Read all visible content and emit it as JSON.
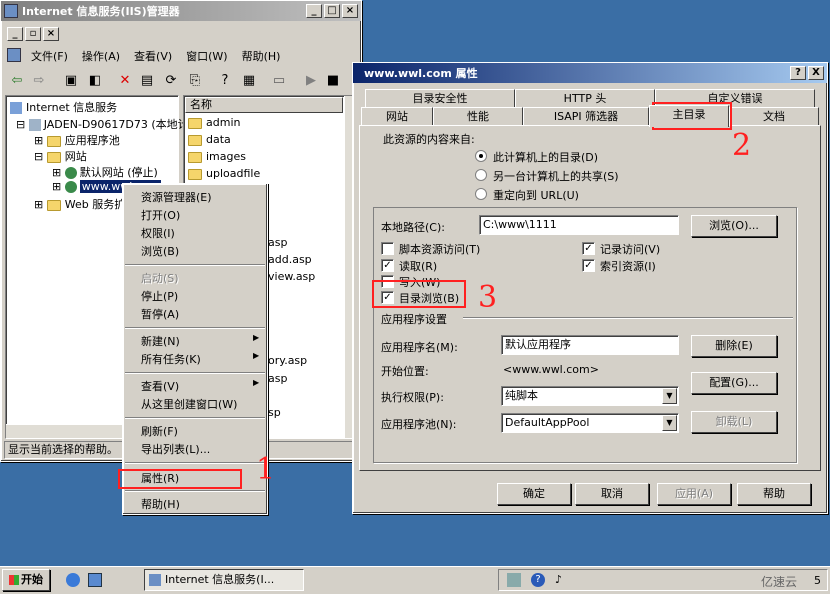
{
  "iis": {
    "title": "Internet 信息服务(IIS)管理器",
    "menu": [
      "文件(F)",
      "操作(A)",
      "查看(V)",
      "窗口(W)",
      "帮助(H)"
    ],
    "tree": {
      "root": "Internet 信息服务",
      "server": "JADEN-D90617D73 (本地计",
      "app_pools": "应用程序池",
      "websites": "网站",
      "default_site": "默认网站 (停止)",
      "site_www": "www.wwl.com",
      "web_ext": "Web 服务扩"
    },
    "list_header": "名称",
    "list_items": [
      "admin",
      "data",
      "images",
      "uploadfile"
    ],
    "list_partial": [
      "asp",
      "add.asp",
      "view.asp",
      "ory.asp",
      "asp",
      "sp"
    ],
    "status_text": "显示当前选择的帮助。"
  },
  "context_menu": {
    "items": [
      {
        "label": "资源管理器(E)",
        "disabled": false
      },
      {
        "label": "打开(O)",
        "disabled": false
      },
      {
        "label": "权限(I)",
        "disabled": false
      },
      {
        "label": "浏览(B)",
        "disabled": false
      },
      {
        "label": "启动(S)",
        "disabled": true
      },
      {
        "label": "停止(P)",
        "disabled": false
      },
      {
        "label": "暂停(A)",
        "disabled": false
      },
      {
        "label": "新建(N)",
        "disabled": false
      },
      {
        "label": "所有任务(K)",
        "disabled": false
      },
      {
        "label": "查看(V)",
        "disabled": false
      },
      {
        "label": "从这里创建窗口(W)",
        "disabled": false
      },
      {
        "label": "刷新(F)",
        "disabled": false
      },
      {
        "label": "导出列表(L)...",
        "disabled": false
      },
      {
        "label": "属性(R)",
        "disabled": false
      },
      {
        "label": "帮助(H)",
        "disabled": false
      }
    ]
  },
  "props": {
    "title": "www.wwl.com 属性",
    "tabs_row1": [
      "目录安全性",
      "HTTP 头",
      "自定义错误"
    ],
    "tabs_row2": [
      "网站",
      "性能",
      "ISAPI 筛选器",
      "主目录",
      "文档"
    ],
    "content_source_label": "此资源的内容来自:",
    "radio_options": [
      "此计算机上的目录(D)",
      "另一台计算机上的共享(S)",
      "重定向到 URL(U)"
    ],
    "local_path_label": "本地路径(C):",
    "local_path_value": "C:\\www\\1111",
    "browse_button": "浏览(O)...",
    "checkboxes": {
      "script_source": {
        "label": "脚本资源访问(T)",
        "checked": false
      },
      "read": {
        "label": "读取(R)",
        "checked": true
      },
      "write": {
        "label": "写入(W)",
        "checked": false
      },
      "dir_browse": {
        "label": "目录浏览(B)",
        "checked": true
      },
      "log_visits": {
        "label": "记录访问(V)",
        "checked": true
      },
      "index_resource": {
        "label": "索引资源(I)",
        "checked": true
      }
    },
    "app_settings_label": "应用程序设置",
    "app_name_label": "应用程序名(M):",
    "app_name_value": "默认应用程序",
    "remove_button": "删除(E)",
    "start_point_label": "开始位置:",
    "start_point_value": "<www.wwl.com>",
    "config_button": "配置(G)...",
    "exec_perm_label": "执行权限(P):",
    "exec_perm_value": "纯脚本",
    "app_pool_label": "应用程序池(N):",
    "app_pool_value": "DefaultAppPool",
    "unload_button": "卸载(L)",
    "ok_button": "确定",
    "cancel_button": "取消",
    "apply_button": "应用(A)",
    "help_button": "帮助",
    "help_title_btn": "?",
    "close_title_btn": "X"
  },
  "annotations": {
    "step1": "1",
    "step2": "2",
    "step3": "3"
  },
  "taskbar": {
    "start_label": "开始",
    "task_label": "Internet 信息服务(I...",
    "clock": "5",
    "watermark": "亿速云"
  }
}
